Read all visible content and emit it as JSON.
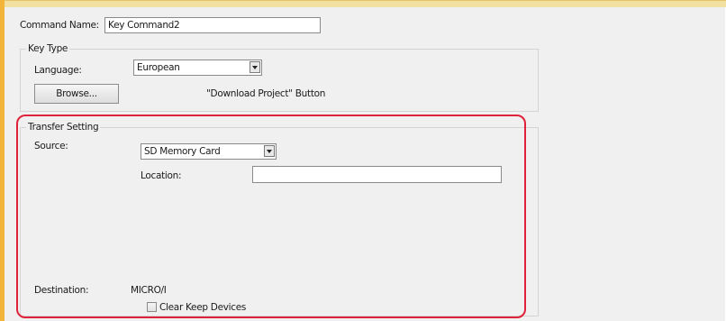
{
  "command_name": {
    "label": "Command Name:",
    "value": "Key Command2"
  },
  "key_type": {
    "title": "Key Type",
    "language_label": "Language:",
    "language_value": "European",
    "browse_label": "Browse...",
    "button_caption": "\"Download Project\" Button"
  },
  "transfer": {
    "title": "Transfer Setting",
    "source_label": "Source:",
    "source_value": "SD Memory Card",
    "location_label": "Location:",
    "location_value": "",
    "destination_label": "Destination:",
    "destination_value": "MICRO/I",
    "clear_keep_label": "Clear Keep Devices",
    "clear_keep_checked": false
  },
  "colors": {
    "highlight": "#e0213a",
    "accent": "#f2b53a"
  }
}
